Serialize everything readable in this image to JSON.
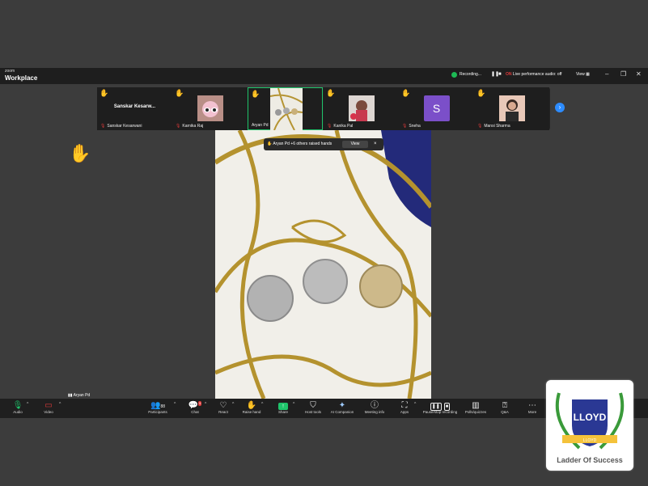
{
  "app": {
    "brand_small": "zoom",
    "brand": "Workplace"
  },
  "titlebar": {
    "recording_label": "Recording...",
    "live_badge": "ON",
    "live_text": "Live performance audio: off",
    "view_label": "View",
    "recording_dot_color": "#1db954"
  },
  "participants": [
    {
      "name": "Sanskar Kesarwani",
      "display": "Sanskar Kesarw...",
      "hand": true,
      "muted": true
    },
    {
      "name": "Karnika Raj",
      "hand": true,
      "muted": true
    },
    {
      "name": "Aryan Pd",
      "hand": true,
      "muted": false,
      "active": true
    },
    {
      "name": "Kanika Pal",
      "hand": true,
      "muted": true
    },
    {
      "name": "Sneha",
      "initial": "S",
      "hand": true,
      "muted": true
    },
    {
      "name": "Mansi Sharma",
      "hand": true,
      "muted": true
    }
  ],
  "notification": {
    "text": "Aryan Pd +6 others raised hands",
    "view_label": "View",
    "close": "×"
  },
  "active_speaker_label": "Aryan Pd",
  "toolbar": {
    "audio": "Audio",
    "video": "Video",
    "participants": "Participants",
    "participants_count": "88",
    "chat": "Chat",
    "chat_badge": "5",
    "react": "React",
    "raise_hand": "Raise hand",
    "share": "Share",
    "host_tools": "Host tools",
    "ai_companion": "AI Companion",
    "meeting_info": "Meeting info",
    "apps": "Apps",
    "pause_stop_recording": "Pause/stop recording",
    "polls": "Polls/quizzes",
    "qa": "Q&A",
    "more": "More"
  },
  "watermark": {
    "brand": "LLOYD",
    "ribbon": "LLOYD",
    "tagline": "Ladder Of Success"
  }
}
